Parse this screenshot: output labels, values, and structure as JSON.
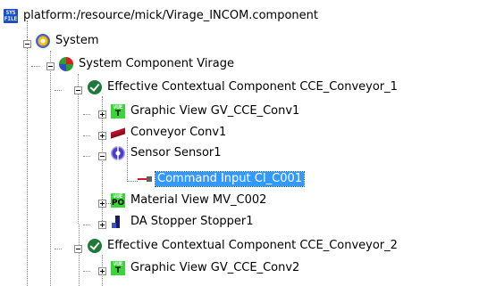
{
  "tree": {
    "root": {
      "label": "platform:/resource/mick/Virage_INCOM.component",
      "icon": "sys-file-icon",
      "icon_text": [
        "SYS",
        "FILE"
      ]
    },
    "nodes": [
      {
        "label": "System",
        "icon": "system-icon",
        "state": "expanded"
      },
      {
        "label": "System Component Virage",
        "icon": "system-component-icon",
        "state": "expanded"
      },
      {
        "label": "Effective Contextual Component CCE_Conveyor_1",
        "icon": "check-icon",
        "state": "expanded"
      },
      {
        "label": "Graphic View GV_CCE_Conv1",
        "icon": "vue-t-icon",
        "icon_text": [
          "VUE",
          "T"
        ],
        "state": "collapsed"
      },
      {
        "label": "Conveyor Conv1",
        "icon": "conveyor-icon",
        "state": "collapsed"
      },
      {
        "label": "Sensor Sensor1",
        "icon": "sensor-icon",
        "state": "expanded"
      },
      {
        "label": "Command Input CI_C001",
        "icon": "command-input-icon",
        "state": "leaf",
        "selected": true
      },
      {
        "label": "Material View MV_C002",
        "icon": "vue-po-icon",
        "icon_text": [
          "VUE",
          "PO"
        ],
        "state": "collapsed"
      },
      {
        "label": "DA Stopper Stopper1",
        "icon": "stopper-icon",
        "state": "collapsed"
      },
      {
        "label": "Effective Contextual Component CCE_Conveyor_2",
        "icon": "check-icon",
        "state": "expanded"
      },
      {
        "label": "Graphic View GV_CCE_Conv2",
        "icon": "vue-t-icon",
        "icon_text": [
          "VUE",
          "T"
        ],
        "state": "collapsed"
      }
    ],
    "colors": {
      "selection": "#3399ff",
      "connector": "#8a8a8a",
      "vue_green": "#39d63a"
    }
  }
}
